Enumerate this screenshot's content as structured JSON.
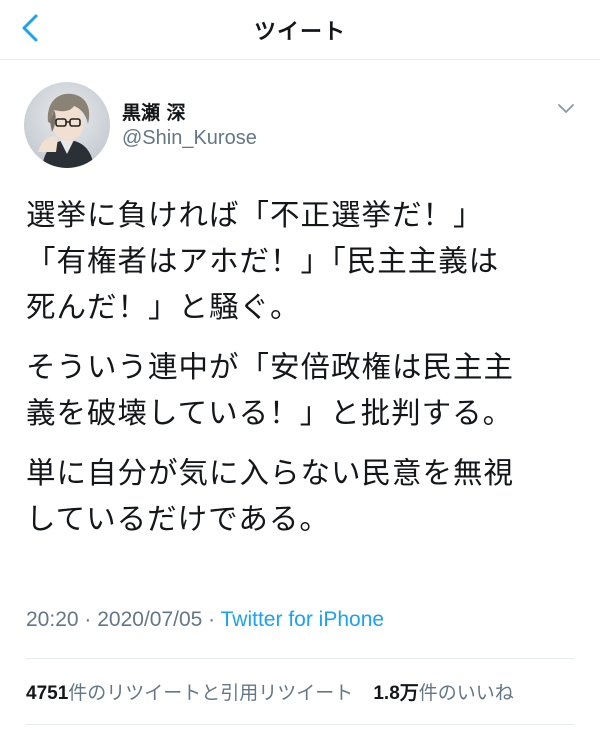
{
  "nav": {
    "title": "ツイート",
    "back_icon": "chevron-left-icon"
  },
  "colors": {
    "accent": "#1da1f2",
    "secondary_text": "#657786",
    "text": "#14171a",
    "divider": "#e6ecf0"
  },
  "tweet": {
    "author_name": "黒瀬 深",
    "author_handle": "@Shin_Kurose",
    "paragraphs": [
      "選挙に負ければ「不正選挙だ！」\n「有権者はアホだ！」「民主主義は\n死んだ！」と騒ぐ。",
      "そういう連中が「安倍政権は民主主\n義を破壊している！」と批判する。",
      "単に自分が気に入らない民意を無視\nしているだけである。"
    ],
    "time": "20:20",
    "date": "2020/07/05",
    "source": "Twitter for iPhone",
    "separator": " · "
  },
  "stats": {
    "retweets_count": "4751",
    "retweets_label": "件のリツイートと引用リツイート",
    "likes_count": "1.8万",
    "likes_label": "件のいいね"
  }
}
